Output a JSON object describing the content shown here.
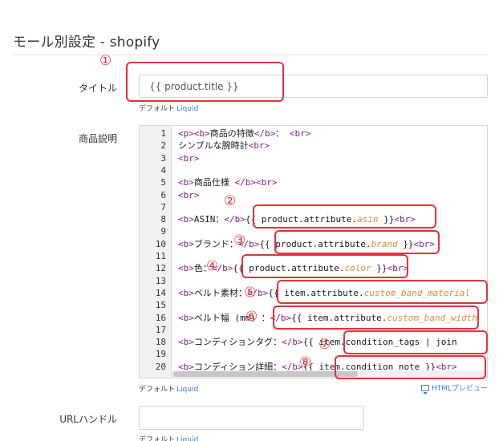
{
  "section": {
    "title": "モール別設定 - shopify"
  },
  "fields": {
    "title_label": "タイトル",
    "title_value": "{{ product.title }}",
    "description_label": "商品説明",
    "url_label": "URLハンドル",
    "url_value": ""
  },
  "helpers": {
    "default": "デフォルト",
    "liquid": "Liquid",
    "html_preview": "HTMLプレビュー"
  },
  "code": {
    "line_numbers": [
      "1",
      "2",
      "3",
      "4",
      "5",
      "6",
      "7",
      "8",
      "9",
      "10",
      "11",
      "12",
      "13",
      "14",
      "15",
      "16",
      "17",
      "18",
      "19",
      "20"
    ],
    "lines": [
      [
        {
          "t": "<p><b>",
          "c": "tag"
        },
        {
          "t": "商品の特徴",
          "c": "var"
        },
        {
          "t": "</b>",
          "c": "tag"
        },
        {
          "t": "： ",
          "c": "var"
        },
        {
          "t": "<br>",
          "c": "tag"
        }
      ],
      [
        {
          "t": "シンプルな腕時計",
          "c": "var"
        },
        {
          "t": "<br>",
          "c": "tag"
        }
      ],
      [
        {
          "t": "<br>",
          "c": "tag"
        }
      ],
      [],
      [
        {
          "t": "<b>",
          "c": "tag"
        },
        {
          "t": "商品仕様 ",
          "c": "var"
        },
        {
          "t": "</b>",
          "c": "tag"
        },
        {
          "t": "<br>",
          "c": "tag"
        }
      ],
      [
        {
          "t": "<br>",
          "c": "tag"
        }
      ],
      [],
      [
        {
          "t": "<b>",
          "c": "tag"
        },
        {
          "t": "ASIN：",
          "c": "var"
        },
        {
          "t": "</b>",
          "c": "tag"
        },
        {
          "t": "{{ product.attribute.",
          "c": "var"
        },
        {
          "t": "asin",
          "c": "attr"
        },
        {
          "t": " }}",
          "c": "var"
        },
        {
          "t": "<br>",
          "c": "tag"
        }
      ],
      [],
      [
        {
          "t": "<b>",
          "c": "tag"
        },
        {
          "t": "ブランド：",
          "c": "var"
        },
        {
          "t": "</b>",
          "c": "tag"
        },
        {
          "t": "{{ product.attribute.",
          "c": "var"
        },
        {
          "t": "brand",
          "c": "attr"
        },
        {
          "t": " }}",
          "c": "var"
        },
        {
          "t": "<br>",
          "c": "tag"
        }
      ],
      [],
      [
        {
          "t": "<b>",
          "c": "tag"
        },
        {
          "t": "色：",
          "c": "var"
        },
        {
          "t": "</b>",
          "c": "tag"
        },
        {
          "t": "{{ product.attribute.",
          "c": "var"
        },
        {
          "t": "color",
          "c": "attr"
        },
        {
          "t": " }}",
          "c": "var"
        },
        {
          "t": "<br>",
          "c": "tag"
        }
      ],
      [],
      [
        {
          "t": "<b>",
          "c": "tag"
        },
        {
          "t": "ベルト素材：",
          "c": "var"
        },
        {
          "t": "</b>",
          "c": "tag"
        },
        {
          "t": "{{ item.attribute.",
          "c": "var"
        },
        {
          "t": "custom_band_material",
          "c": "attr"
        }
      ],
      [],
      [
        {
          "t": "<b>",
          "c": "tag"
        },
        {
          "t": "ベルト幅 (mm) ：",
          "c": "var"
        },
        {
          "t": "</b>",
          "c": "tag"
        },
        {
          "t": "{{ item.attribute.",
          "c": "var"
        },
        {
          "t": "custom_band_width",
          "c": "attr"
        }
      ],
      [],
      [
        {
          "t": "<b>",
          "c": "tag"
        },
        {
          "t": "コンディションタグ：",
          "c": "var"
        },
        {
          "t": "</b>",
          "c": "tag"
        },
        {
          "t": "{{ item.condition_tags | join",
          "c": "var"
        }
      ],
      [],
      [
        {
          "t": "<b>",
          "c": "tag"
        },
        {
          "t": "コンディション詳細：",
          "c": "var"
        },
        {
          "t": "</b>",
          "c": "tag"
        },
        {
          "t": "{{ item.condition_note }}",
          "c": "var"
        },
        {
          "t": "<br>",
          "c": "tag"
        }
      ]
    ]
  },
  "annotations": [
    "①",
    "②",
    "③",
    "④",
    "⑤",
    "⑥",
    "⑦",
    "⑧"
  ],
  "colors": {
    "highlight": "#e5323b",
    "link": "#3b7fd4",
    "tag": "#8a1f8a",
    "attribute": "#e08a3c"
  }
}
